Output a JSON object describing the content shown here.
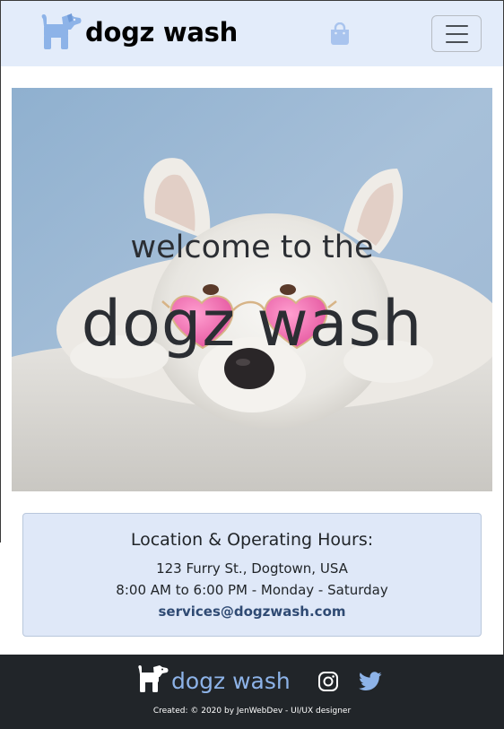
{
  "navbar": {
    "brand": "dogz wash",
    "brand_icon": "dog-icon",
    "cart_icon": "shopping-bag-icon",
    "menu_icon": "hamburger-menu-icon"
  },
  "hero": {
    "line1": "welcome to the",
    "line2": "dogz wash"
  },
  "info": {
    "title": "Location & Operating Hours:",
    "address": "123 Furry St., Dogtown, USA",
    "hours": "8:00 AM to 6:00 PM - Monday - Saturday",
    "email": "services@dogzwash.com"
  },
  "footer": {
    "brand": "dogz wash",
    "brand_icon": "dog-icon",
    "social": [
      "instagram-icon",
      "twitter-icon"
    ],
    "credit": "Created: © 2020 by JenWebDev - UI/UX designer"
  },
  "colors": {
    "navbar_bg": "#e3ecfa",
    "card_bg": "#dfe8f8",
    "footer_bg": "#212529",
    "accent": "#8db3e8",
    "email": "#2f4a73"
  }
}
